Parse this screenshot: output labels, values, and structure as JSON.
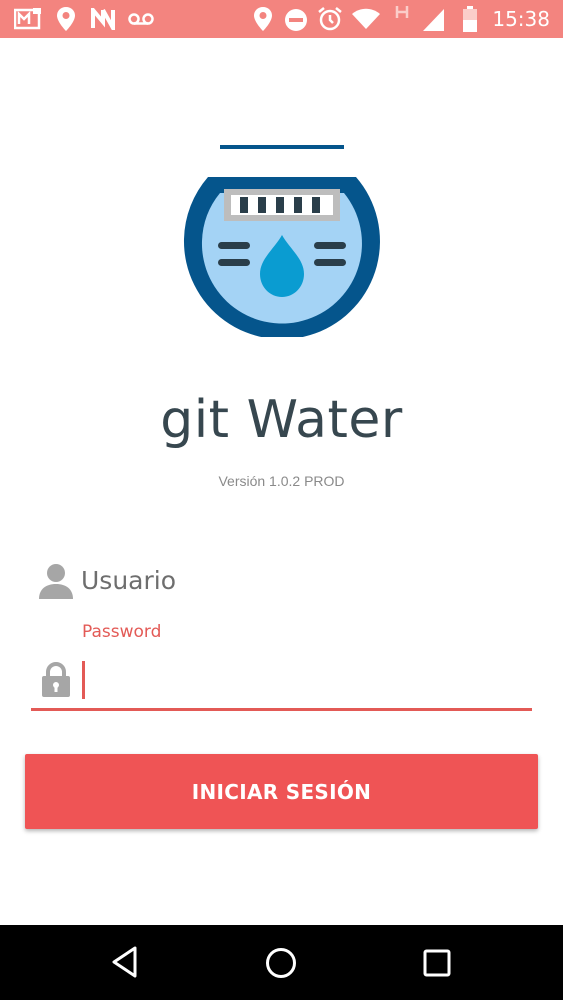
{
  "status_bar": {
    "time": "15:38",
    "left_icons": [
      "gallery-icon",
      "location-icon",
      "n-icon",
      "voicemail-icon"
    ],
    "right_icons": [
      "location-icon",
      "do-not-disturb-icon",
      "alarm-icon",
      "wifi-icon",
      "signal-h-icon",
      "battery-icon"
    ],
    "background": "#f3847f"
  },
  "app": {
    "title": "git Water",
    "version": "Versión 1.0.2 PROD",
    "logo_icon": "water-meter-icon"
  },
  "form": {
    "username_placeholder": "Usuario",
    "username_value": "",
    "password_label": "Password",
    "password_value": "",
    "accent_color": "#e35a56"
  },
  "login_button": {
    "label": "INICIAR SESIÓN",
    "color": "#ef5455"
  },
  "nav_bar": {
    "buttons": [
      "back-icon",
      "home-icon",
      "recents-icon"
    ]
  }
}
